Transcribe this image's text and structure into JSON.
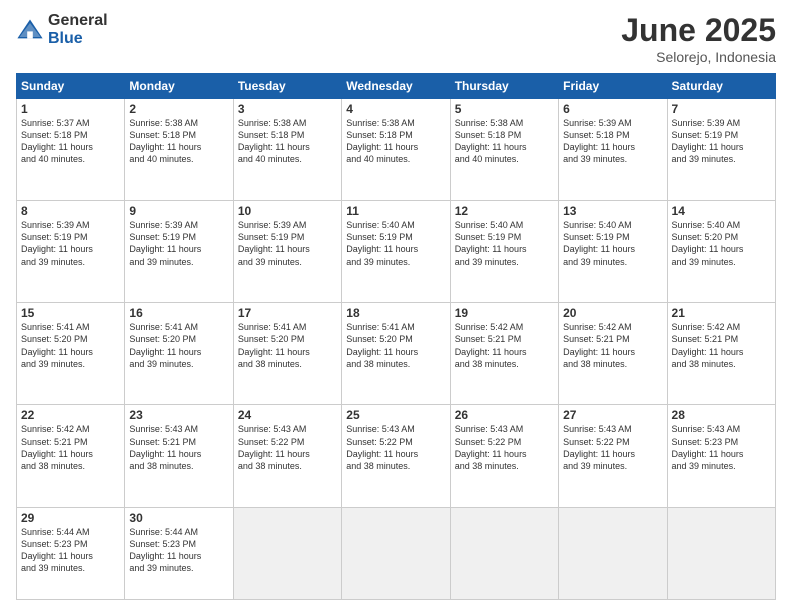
{
  "logo": {
    "general": "General",
    "blue": "Blue"
  },
  "title": {
    "month": "June 2025",
    "location": "Selorejo, Indonesia"
  },
  "headers": [
    "Sunday",
    "Monday",
    "Tuesday",
    "Wednesday",
    "Thursday",
    "Friday",
    "Saturday"
  ],
  "weeks": [
    [
      {
        "day": "1",
        "info": "Sunrise: 5:37 AM\nSunset: 5:18 PM\nDaylight: 11 hours\nand 40 minutes."
      },
      {
        "day": "2",
        "info": "Sunrise: 5:38 AM\nSunset: 5:18 PM\nDaylight: 11 hours\nand 40 minutes."
      },
      {
        "day": "3",
        "info": "Sunrise: 5:38 AM\nSunset: 5:18 PM\nDaylight: 11 hours\nand 40 minutes."
      },
      {
        "day": "4",
        "info": "Sunrise: 5:38 AM\nSunset: 5:18 PM\nDaylight: 11 hours\nand 40 minutes."
      },
      {
        "day": "5",
        "info": "Sunrise: 5:38 AM\nSunset: 5:18 PM\nDaylight: 11 hours\nand 40 minutes."
      },
      {
        "day": "6",
        "info": "Sunrise: 5:39 AM\nSunset: 5:18 PM\nDaylight: 11 hours\nand 39 minutes."
      },
      {
        "day": "7",
        "info": "Sunrise: 5:39 AM\nSunset: 5:19 PM\nDaylight: 11 hours\nand 39 minutes."
      }
    ],
    [
      {
        "day": "8",
        "info": "Sunrise: 5:39 AM\nSunset: 5:19 PM\nDaylight: 11 hours\nand 39 minutes."
      },
      {
        "day": "9",
        "info": "Sunrise: 5:39 AM\nSunset: 5:19 PM\nDaylight: 11 hours\nand 39 minutes."
      },
      {
        "day": "10",
        "info": "Sunrise: 5:39 AM\nSunset: 5:19 PM\nDaylight: 11 hours\nand 39 minutes."
      },
      {
        "day": "11",
        "info": "Sunrise: 5:40 AM\nSunset: 5:19 PM\nDaylight: 11 hours\nand 39 minutes."
      },
      {
        "day": "12",
        "info": "Sunrise: 5:40 AM\nSunset: 5:19 PM\nDaylight: 11 hours\nand 39 minutes."
      },
      {
        "day": "13",
        "info": "Sunrise: 5:40 AM\nSunset: 5:19 PM\nDaylight: 11 hours\nand 39 minutes."
      },
      {
        "day": "14",
        "info": "Sunrise: 5:40 AM\nSunset: 5:20 PM\nDaylight: 11 hours\nand 39 minutes."
      }
    ],
    [
      {
        "day": "15",
        "info": "Sunrise: 5:41 AM\nSunset: 5:20 PM\nDaylight: 11 hours\nand 39 minutes."
      },
      {
        "day": "16",
        "info": "Sunrise: 5:41 AM\nSunset: 5:20 PM\nDaylight: 11 hours\nand 39 minutes."
      },
      {
        "day": "17",
        "info": "Sunrise: 5:41 AM\nSunset: 5:20 PM\nDaylight: 11 hours\nand 38 minutes."
      },
      {
        "day": "18",
        "info": "Sunrise: 5:41 AM\nSunset: 5:20 PM\nDaylight: 11 hours\nand 38 minutes."
      },
      {
        "day": "19",
        "info": "Sunrise: 5:42 AM\nSunset: 5:21 PM\nDaylight: 11 hours\nand 38 minutes."
      },
      {
        "day": "20",
        "info": "Sunrise: 5:42 AM\nSunset: 5:21 PM\nDaylight: 11 hours\nand 38 minutes."
      },
      {
        "day": "21",
        "info": "Sunrise: 5:42 AM\nSunset: 5:21 PM\nDaylight: 11 hours\nand 38 minutes."
      }
    ],
    [
      {
        "day": "22",
        "info": "Sunrise: 5:42 AM\nSunset: 5:21 PM\nDaylight: 11 hours\nand 38 minutes."
      },
      {
        "day": "23",
        "info": "Sunrise: 5:43 AM\nSunset: 5:21 PM\nDaylight: 11 hours\nand 38 minutes."
      },
      {
        "day": "24",
        "info": "Sunrise: 5:43 AM\nSunset: 5:22 PM\nDaylight: 11 hours\nand 38 minutes."
      },
      {
        "day": "25",
        "info": "Sunrise: 5:43 AM\nSunset: 5:22 PM\nDaylight: 11 hours\nand 38 minutes."
      },
      {
        "day": "26",
        "info": "Sunrise: 5:43 AM\nSunset: 5:22 PM\nDaylight: 11 hours\nand 38 minutes."
      },
      {
        "day": "27",
        "info": "Sunrise: 5:43 AM\nSunset: 5:22 PM\nDaylight: 11 hours\nand 39 minutes."
      },
      {
        "day": "28",
        "info": "Sunrise: 5:43 AM\nSunset: 5:23 PM\nDaylight: 11 hours\nand 39 minutes."
      }
    ],
    [
      {
        "day": "29",
        "info": "Sunrise: 5:44 AM\nSunset: 5:23 PM\nDaylight: 11 hours\nand 39 minutes."
      },
      {
        "day": "30",
        "info": "Sunrise: 5:44 AM\nSunset: 5:23 PM\nDaylight: 11 hours\nand 39 minutes."
      },
      {
        "day": "",
        "info": ""
      },
      {
        "day": "",
        "info": ""
      },
      {
        "day": "",
        "info": ""
      },
      {
        "day": "",
        "info": ""
      },
      {
        "day": "",
        "info": ""
      }
    ]
  ]
}
